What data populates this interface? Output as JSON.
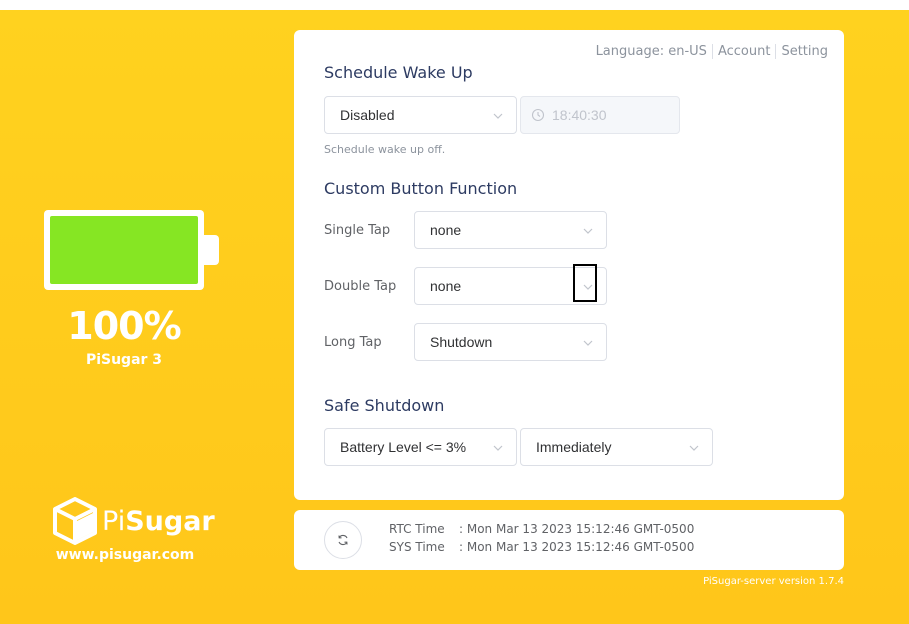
{
  "battery": {
    "level_fraction": 1.0,
    "percent_text": "100%",
    "model": "PiSugar 3",
    "fill_color": "#86e623"
  },
  "brand": {
    "logo_prefix": "Pi",
    "logo_suffix": "Sugar",
    "website": "www.pisugar.com"
  },
  "header_links": {
    "language": "Language: en-US",
    "account": "Account",
    "setting": "Setting"
  },
  "schedule": {
    "title": "Schedule Wake Up",
    "mode_value": "Disabled",
    "time_value": "18:40:30",
    "hint": "Schedule wake up off."
  },
  "custom_button": {
    "title": "Custom Button Function",
    "rows": [
      {
        "label": "Single Tap",
        "value": "none"
      },
      {
        "label": "Double Tap",
        "value": "none"
      },
      {
        "label": "Long Tap",
        "value": "Shutdown"
      }
    ]
  },
  "safe_shutdown": {
    "title": "Safe Shutdown",
    "level_value": "Battery Level <= 3%",
    "delay_value": "Immediately"
  },
  "clock": {
    "rtc_label": "RTC Time",
    "rtc_value": ": Mon Mar 13 2023 15:12:46 GMT-0500",
    "sys_label": "SYS Time",
    "sys_value": ": Mon Mar 13 2023 15:12:46 GMT-0500"
  },
  "footer": {
    "version": "PiSugar-server version 1.7.4"
  },
  "icons": {
    "refresh": "refresh-icon",
    "clock": "clock-icon",
    "chevron": "chevron-down-icon",
    "logo": "pisugar-cube-icon"
  }
}
